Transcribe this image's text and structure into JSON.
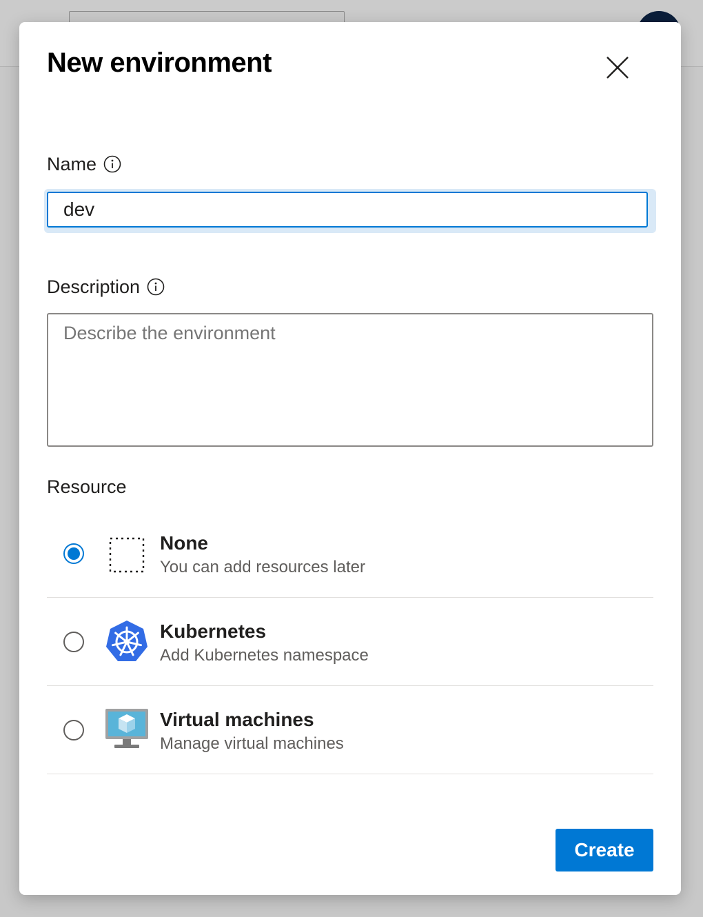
{
  "dialog": {
    "title": "New environment",
    "close_icon": "close-icon"
  },
  "name_field": {
    "label": "Name",
    "value": "dev",
    "info_icon": "info-icon"
  },
  "description_field": {
    "label": "Description",
    "placeholder": "Describe the environment",
    "value": "",
    "info_icon": "info-icon"
  },
  "resource": {
    "label": "Resource",
    "options": [
      {
        "title": "None",
        "subtitle": "You can add resources later",
        "selected": true,
        "icon": "dotted-square-icon"
      },
      {
        "title": "Kubernetes",
        "subtitle": "Add Kubernetes namespace",
        "selected": false,
        "icon": "kubernetes-icon"
      },
      {
        "title": "Virtual machines",
        "subtitle": "Manage virtual machines",
        "selected": false,
        "icon": "virtual-machine-icon"
      }
    ]
  },
  "footer": {
    "create_label": "Create"
  },
  "colors": {
    "accent": "#0078d4",
    "kubernetes_blue": "#326ce5",
    "vm_blue": "#59b4d9"
  }
}
